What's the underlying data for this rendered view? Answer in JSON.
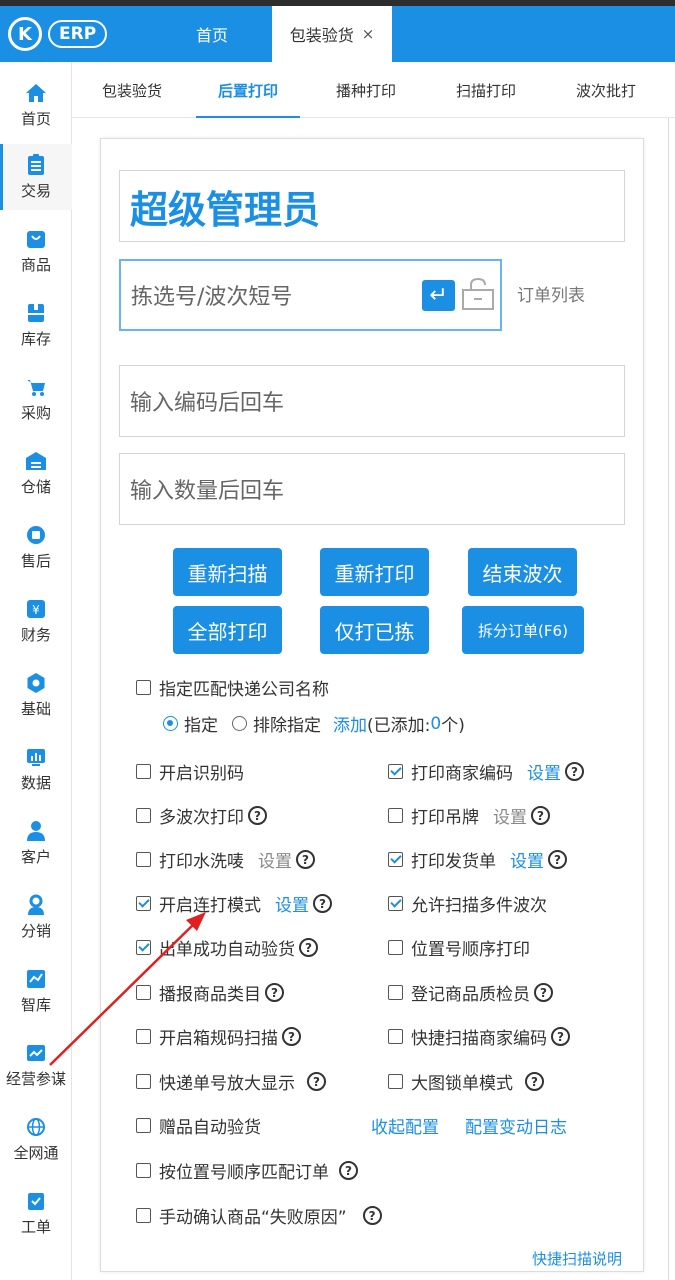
{
  "header": {
    "logo_letter": "K",
    "logo_text": "ERP",
    "tab_home": "首页",
    "tab_active": "包装验货",
    "tab_close": "×"
  },
  "sidebar": {
    "items": [
      {
        "label": "首页",
        "icon": "home-icon"
      },
      {
        "label": "交易",
        "icon": "trade-icon"
      },
      {
        "label": "商品",
        "icon": "goods-icon"
      },
      {
        "label": "库存",
        "icon": "stock-icon"
      },
      {
        "label": "采购",
        "icon": "purchase-icon"
      },
      {
        "label": "仓储",
        "icon": "warehouse-icon"
      },
      {
        "label": "售后",
        "icon": "aftersale-icon"
      },
      {
        "label": "财务",
        "icon": "finance-icon"
      },
      {
        "label": "基础",
        "icon": "gear-icon"
      },
      {
        "label": "数据",
        "icon": "data-icon"
      },
      {
        "label": "客户",
        "icon": "customer-icon"
      },
      {
        "label": "分销",
        "icon": "distribution-icon"
      },
      {
        "label": "智库",
        "icon": "think-tank-icon"
      },
      {
        "label": "经营参谋",
        "icon": "analysis-icon"
      },
      {
        "label": "全网通",
        "icon": "network-icon"
      },
      {
        "label": "工单",
        "icon": "ticket-icon"
      }
    ],
    "active_index": 1
  },
  "subtabs": [
    "包装验货",
    "后置打印",
    "播种打印",
    "扫描打印",
    "波次批打"
  ],
  "main": {
    "user_name": "超级管理员",
    "pick_placeholder": "拣选号/波次短号",
    "order_list": "订单列表",
    "code_placeholder": "输入编码后回车",
    "qty_placeholder": "输入数量后回车",
    "enter_symbol": "↵"
  },
  "buttons": {
    "rescan": "重新扫描",
    "reprint": "重新打印",
    "end_wave": "结束波次",
    "print_all": "全部打印",
    "print_picked": "仅打已拣",
    "split_order": "拆分订单(F6)"
  },
  "express": {
    "label": "指定匹配快递公司名称",
    "radio_specify": "指定",
    "radio_exclude": "排除指定",
    "add": "添加",
    "added_prefix": "(已添加:",
    "added_count": "0",
    "added_suffix": "个)"
  },
  "options": {
    "enable_id_code": "开启识别码",
    "print_merchant_code": "打印商家编码",
    "multi_wave_print": "多波次打印",
    "print_tag": "打印吊牌",
    "print_wash_label": "打印水洗唛",
    "print_invoice": "打印发货单",
    "continuous_mode": "开启连打模式",
    "allow_multi_wave_scan": "允许扫描多件波次",
    "auto_inspect_on_out": "出单成功自动验货",
    "location_order_print": "位置号顺序打印",
    "broadcast_category": "播报商品类目",
    "register_inspector": "登记商品质检员",
    "enable_box_scan": "开启箱规码扫描",
    "quick_scan_merchant_code": "快捷扫描商家编码",
    "enlarge_express_no": "快递单号放大显示",
    "big_image_lock": "大图锁单模式",
    "gift_auto_inspect": "赠品自动验货",
    "collapse_config": "收起配置",
    "config_change_log": "配置变动日志",
    "match_by_location": "按位置号顺序匹配订单",
    "manual_confirm_fail": "手动确认商品“失败原因”",
    "setting": "设置",
    "help": "?"
  },
  "quick_scan_help": "快捷扫描说明",
  "colors": {
    "primary": "#1a8fe3",
    "annotation_arrow": "#e02020"
  }
}
